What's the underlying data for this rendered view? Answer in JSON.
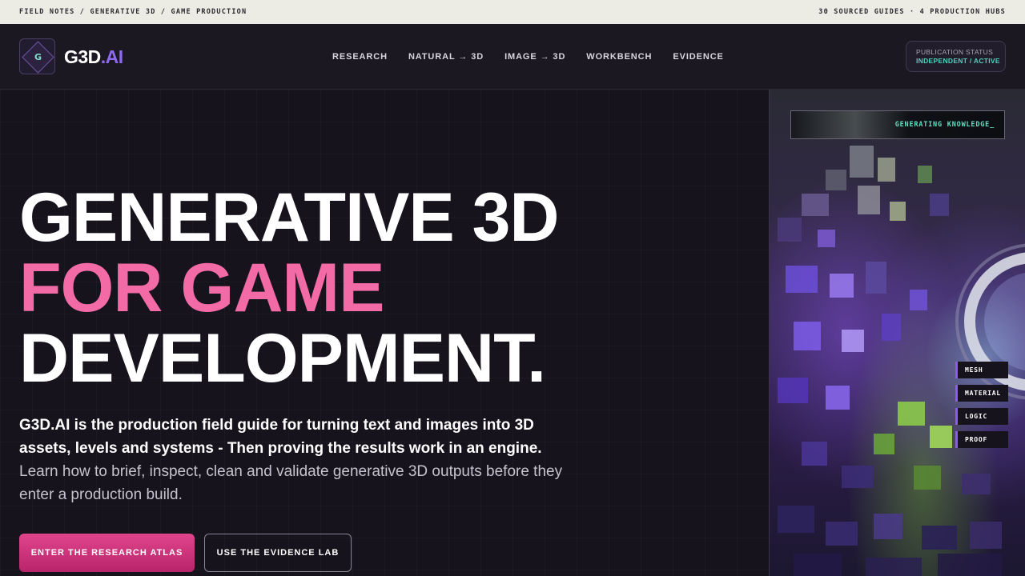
{
  "topbar": {
    "breadcrumb": "FIELD NOTES / GENERATIVE 3D / GAME PRODUCTION",
    "stats": "30 SOURCED GUIDES · 4 PRODUCTION HUBS"
  },
  "header": {
    "logo_letter": "G",
    "brand_main": "G3D",
    "brand_suffix": ".AI",
    "nav": [
      {
        "label": "RESEARCH"
      },
      {
        "label": "NATURAL → 3D"
      },
      {
        "label": "IMAGE → 3D"
      },
      {
        "label": "WORKBENCH"
      },
      {
        "label": "EVIDENCE"
      }
    ],
    "status": {
      "label": "PUBLICATION STATUS",
      "value": "INDEPENDENT / ACTIVE"
    }
  },
  "hero": {
    "line1": "GENERATIVE 3D",
    "line2": "FOR GAME",
    "line3": "DEVELOPMENT.",
    "intro_bold": "G3D.AI is the production field guide for turning text and images into 3D assets, levels and systems - Then proving the results work in an engine.",
    "intro_rest": " Learn how to brief, inspect, clean and validate generative 3D outputs before they enter a production build.",
    "primary_cta": "ENTER THE RESEARCH ATLAS",
    "secondary_cta": "USE THE EVIDENCE LAB"
  },
  "visual": {
    "status_text": "GENERATING KNOWLEDGE_",
    "tags": [
      "MESH",
      "MATERIAL",
      "LOGIC",
      "PROOF"
    ]
  },
  "colors": {
    "accent_pink": "#f26aa6",
    "accent_purple": "#8e6af0",
    "accent_teal": "#4fd1c0",
    "background": "#16131c"
  }
}
